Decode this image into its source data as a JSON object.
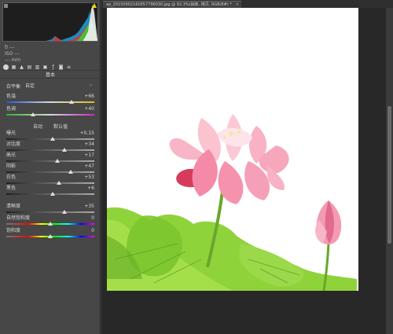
{
  "document": {
    "tab_title": "xp_20150902160057796030.jpg @ 92.3%(抽象, 拷贝, RGB/8#) *",
    "close_glyph": "×"
  },
  "panel": {
    "info_rows": [
      "f/ ---",
      "ISO ---",
      "--- mm"
    ],
    "section_title": "基本",
    "white_balance": {
      "label": "白平衡",
      "value": "自定"
    },
    "auto_label": "自动",
    "default_label": "默认值",
    "sliders_top": [
      {
        "key": "temperature",
        "label": "色温",
        "value": "+66",
        "pos": 0.74
      },
      {
        "key": "tint",
        "label": "色调",
        "value": "+40",
        "pos": 0.3
      }
    ],
    "sliders_tone": [
      {
        "key": "exposure",
        "label": "曝光",
        "value": "+0.15",
        "pos": 0.53
      },
      {
        "key": "contrast",
        "label": "对比度",
        "value": "+34",
        "pos": 0.66
      },
      {
        "key": "highlights",
        "label": "高光",
        "value": "+17",
        "pos": 0.58
      },
      {
        "key": "shadows",
        "label": "阴影",
        "value": "+47",
        "pos": 0.73
      },
      {
        "key": "whites",
        "label": "白色",
        "value": "+53",
        "pos": 0.6
      },
      {
        "key": "blacks",
        "label": "黑色",
        "value": "+6",
        "pos": 0.53
      }
    ],
    "sliders_presence": [
      {
        "key": "clarity",
        "label": "清晰度",
        "value": "+35",
        "pos": 0.66
      },
      {
        "key": "vibrance",
        "label": "自然饱和度",
        "value": "0",
        "pos": 0.5
      },
      {
        "key": "saturation",
        "label": "饱和度",
        "value": "0",
        "pos": 0.5
      }
    ]
  },
  "icons": {
    "histogram_clip_shadow": "clip-shadow-icon",
    "histogram_clip_highlight": "clip-highlight-icon",
    "tools": [
      "basic-icon",
      "tone-curve-icon",
      "detail-icon",
      "hsl-icon",
      "split-tone-icon",
      "lens-icon",
      "fx-icon",
      "camera-calibration-icon",
      "presets-icon"
    ]
  },
  "colors": {
    "panel_bg": "#474747",
    "canvas_bg": "#282828",
    "highlight_clip": "#ffd200",
    "lotus_pink": "#f59ab3",
    "leaf_green": "#8fd33a"
  }
}
